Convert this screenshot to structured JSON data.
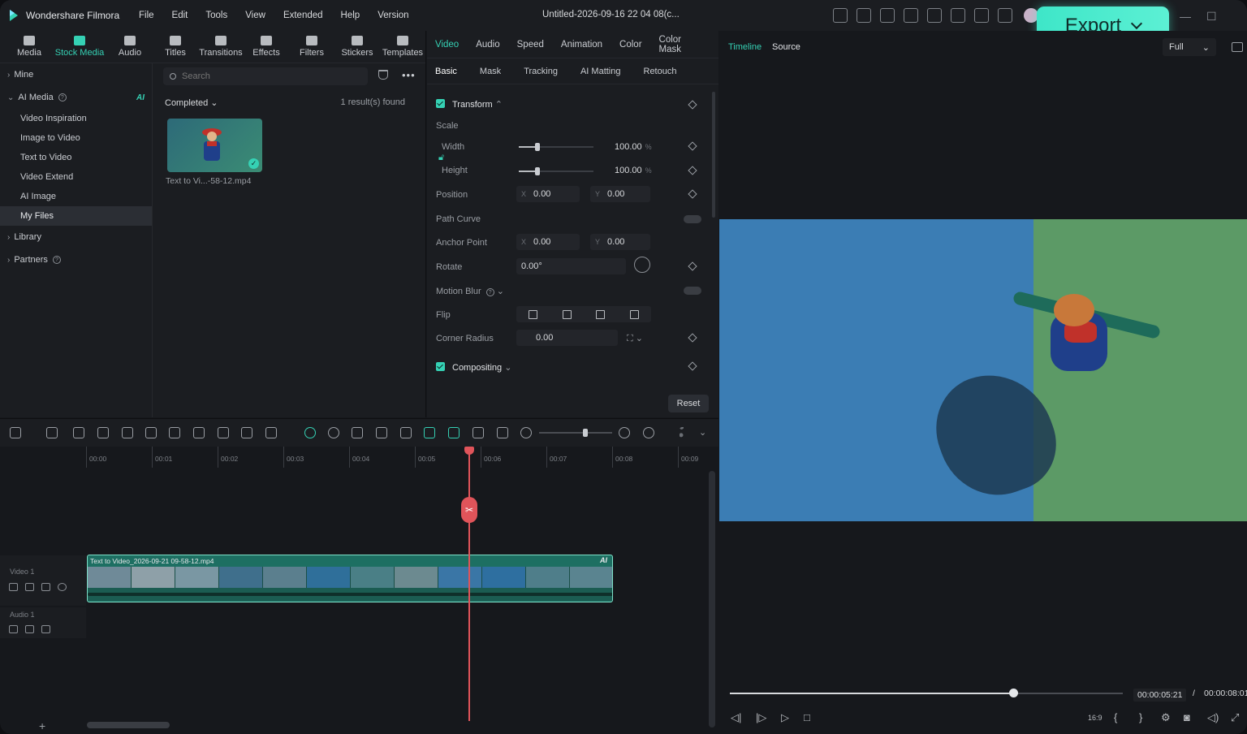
{
  "app": {
    "name": "Wondershare Filmora",
    "doc_title": "Untitled-2026-09-16 22 04 08(c..."
  },
  "menu": [
    "File",
    "Edit",
    "Tools",
    "View",
    "Extended",
    "Help",
    "Version"
  ],
  "export": {
    "label": "Export"
  },
  "media_tabs": [
    "Media",
    "Stock Media",
    "Audio",
    "Titles",
    "Transitions",
    "Effects",
    "Filters",
    "Stickers",
    "Templates"
  ],
  "sidebar": {
    "mine": "Mine",
    "ai_media": "AI Media",
    "ai_badge": "AI",
    "items": [
      "Video Inspiration",
      "Image to Video",
      "Text to Video",
      "Video Extend",
      "AI Image",
      "My Files"
    ],
    "library": "Library",
    "partners": "Partners"
  },
  "browser": {
    "search_placeholder": "Search",
    "filter_label": "Completed",
    "results": "1 result(s) found",
    "clip_name": "Text to Vi...-58-12.mp4"
  },
  "properties": {
    "tabs": [
      "Video",
      "Audio",
      "Speed",
      "Animation",
      "Color",
      "Color Mask"
    ],
    "subtabs": [
      "Basic",
      "Mask",
      "Tracking",
      "AI Matting",
      "Retouch"
    ],
    "transform": "Transform",
    "scale": "Scale",
    "width_label": "Width",
    "width_value": "100.00",
    "width_unit": "%",
    "height_label": "Height",
    "height_value": "100.00",
    "height_unit": "%",
    "position": "Position",
    "pos_x": "0.00",
    "pos_y": "0.00",
    "path_curve": "Path Curve",
    "anchor_point": "Anchor Point",
    "anchor_x": "0.00",
    "anchor_y": "0.00",
    "rotate": "Rotate",
    "rotate_value": "0.00°",
    "motion_blur": "Motion Blur",
    "flip": "Flip",
    "corner_radius": "Corner Radius",
    "corner_value": "0.00",
    "compositing": "Compositing",
    "axis_x": "X",
    "axis_y": "Y",
    "reset": "Reset",
    "scale_fraction": 0.25
  },
  "player": {
    "tab_timeline": "Timeline",
    "tab_source": "Source",
    "quality": "Full",
    "current_time": "00:00:05:21",
    "separator": "/",
    "total_time": "00:00:08:01",
    "aspect": "16:9",
    "progress_fraction": 0.72
  },
  "timeline": {
    "ticks": [
      "00:00",
      "00:01",
      "00:02",
      "00:03",
      "00:04",
      "00:05",
      "00:06",
      "00:07",
      "00:08",
      "00:09"
    ],
    "video_track": "Video 1",
    "audio_track": "Audio 1",
    "clip_title": "Text to Video_2026-09-21 09-58-12.mp4",
    "clip_ai": "AI",
    "zoom_fraction": 0.6
  },
  "colors": {
    "accent": "#35d1b4",
    "playhead": "#e0545a",
    "export_bg": "#3ee6c8"
  }
}
